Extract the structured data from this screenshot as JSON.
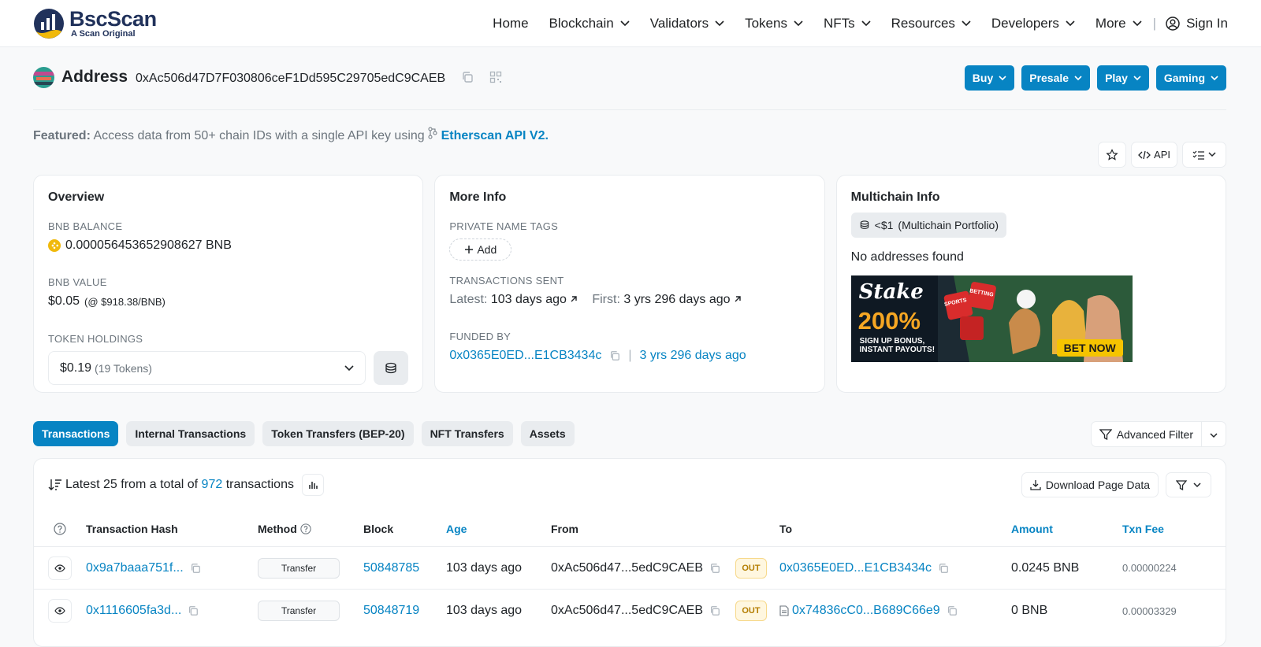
{
  "brand": {
    "name": "BscScan",
    "tagline": "A Scan Original"
  },
  "nav": {
    "items": [
      {
        "label": "Home",
        "dropdown": false
      },
      {
        "label": "Blockchain",
        "dropdown": true
      },
      {
        "label": "Validators",
        "dropdown": true
      },
      {
        "label": "Tokens",
        "dropdown": true
      },
      {
        "label": "NFTs",
        "dropdown": true
      },
      {
        "label": "Resources",
        "dropdown": true
      },
      {
        "label": "Developers",
        "dropdown": true
      },
      {
        "label": "More",
        "dropdown": true
      }
    ],
    "separator": "|",
    "signin": "Sign In"
  },
  "address": {
    "label": "Address",
    "value": "0xAc506d47D7F030806ceF1Dd595C29705edC9CAEB"
  },
  "ad_buttons": [
    "Buy",
    "Presale",
    "Play",
    "Gaming"
  ],
  "featured": {
    "prefix": "Featured:",
    "text": "Access data from 50+ chain IDs with a single API key using",
    "link": "Etherscan API V2."
  },
  "tools": {
    "api_label": "API"
  },
  "overview": {
    "title": "Overview",
    "balance_label": "BNB BALANCE",
    "balance_value": "0.000056453652908627 BNB",
    "value_label": "BNB VALUE",
    "value_main": "$0.05",
    "value_rate": "(@ $918.38/BNB)",
    "holdings_label": "TOKEN HOLDINGS",
    "holdings_value": "$0.19",
    "holdings_count": "(19 Tokens)"
  },
  "more_info": {
    "title": "More Info",
    "tags_label": "PRIVATE NAME TAGS",
    "add_label": "Add",
    "sent_label": "TRANSACTIONS SENT",
    "latest_label": "Latest:",
    "latest_value": "103 days ago",
    "first_label": "First:",
    "first_value": "3 yrs 296 days ago",
    "funded_label": "FUNDED BY",
    "funded_addr": "0x0365E0ED...E1CB3434c",
    "funded_sep": "|",
    "funded_age": "3 yrs 296 days ago"
  },
  "multichain": {
    "title": "Multichain Info",
    "portfolio_value": "<$1",
    "portfolio_label": "(Multichain Portfolio)",
    "empty_text": "No addresses found",
    "banner": {
      "brand": "Stake",
      "promo": "200%",
      "line1": "SIGN UP BONUS,",
      "line2": "INSTANT PAYOUTS!",
      "cta": "BET NOW",
      "die1": "SPORTS",
      "die2": "BETTING"
    }
  },
  "tabs": [
    {
      "label": "Transactions",
      "active": true
    },
    {
      "label": "Internal Transactions",
      "active": false
    },
    {
      "label": "Token Transfers (BEP-20)",
      "active": false
    },
    {
      "label": "NFT Transfers",
      "active": false
    },
    {
      "label": "Assets",
      "active": false
    }
  ],
  "advanced_filter": "Advanced Filter",
  "tx_summary": {
    "prefix": "Latest 25 from a total of",
    "count": "972",
    "suffix": "transactions",
    "download": "Download Page Data"
  },
  "tx_table": {
    "columns": [
      "Transaction Hash",
      "Method",
      "Block",
      "Age",
      "From",
      "To",
      "Amount",
      "Txn Fee"
    ],
    "rows": [
      {
        "hash": "0x9a7baaa751f...",
        "method": "Transfer",
        "block": "50848785",
        "age": "103 days ago",
        "from": "0xAc506d47...5edC9CAEB",
        "direction": "OUT",
        "to": "0x0365E0ED...E1CB3434c",
        "to_is_contract": false,
        "amount": "0.0245 BNB",
        "fee": "0.00000224"
      },
      {
        "hash": "0x1116605fa3d...",
        "method": "Transfer",
        "block": "50848719",
        "age": "103 days ago",
        "from": "0xAc506d47...5edC9CAEB",
        "direction": "OUT",
        "to": "0x74836cC0...B689C66e9",
        "to_is_contract": true,
        "amount": "0 BNB",
        "fee": "0.00003329"
      }
    ]
  },
  "colors": {
    "accent": "#0784c3",
    "brand_dark": "#21325b",
    "out_badge": "#b47d00"
  }
}
